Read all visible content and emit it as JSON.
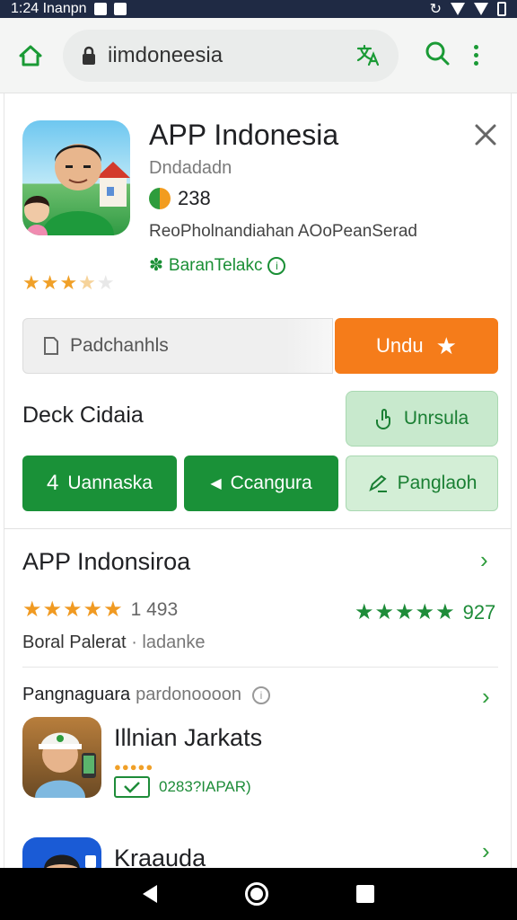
{
  "status_bar": {
    "time_text": "1:24 Inanpn"
  },
  "url_bar": {
    "url": "iimdoneesia"
  },
  "app": {
    "title": "APP Indonesia",
    "developer": "Dndadadn",
    "rating_count": "238",
    "description": "ReoPholnandiahan AOoPeanSerad",
    "verified_label": "BaranTelakc",
    "stars_display": "★★★★★"
  },
  "actions": {
    "secondary_label": "Padchanhls",
    "primary_label": "Undu",
    "section_label": "Deck Cidaia",
    "install_label": "Unrsula",
    "btn1_label": "Uannaska",
    "btn2_label": "Ccangura",
    "btn3_label": "Panglaoh"
  },
  "details": {
    "title": "APP Indonsiroa",
    "rating_count_left": "1 493",
    "rating_count_right": "927",
    "author": "Boral Palerat",
    "author_sep": "·",
    "author_extra": "ladanke",
    "stars_left": "★★★★★",
    "stars_right": "★★★★★"
  },
  "similar": {
    "label": "Pangnaguara",
    "label_extra": "pardonoooon",
    "items": [
      {
        "title": "Illnian Jarkats",
        "dots": "●●●●●",
        "tag": "0283?IAPAR)"
      },
      {
        "title": "Kraauda"
      }
    ]
  },
  "colors": {
    "accent_orange": "#f57c1a",
    "accent_green": "#1a9138",
    "status_bar": "#1f2a44"
  }
}
